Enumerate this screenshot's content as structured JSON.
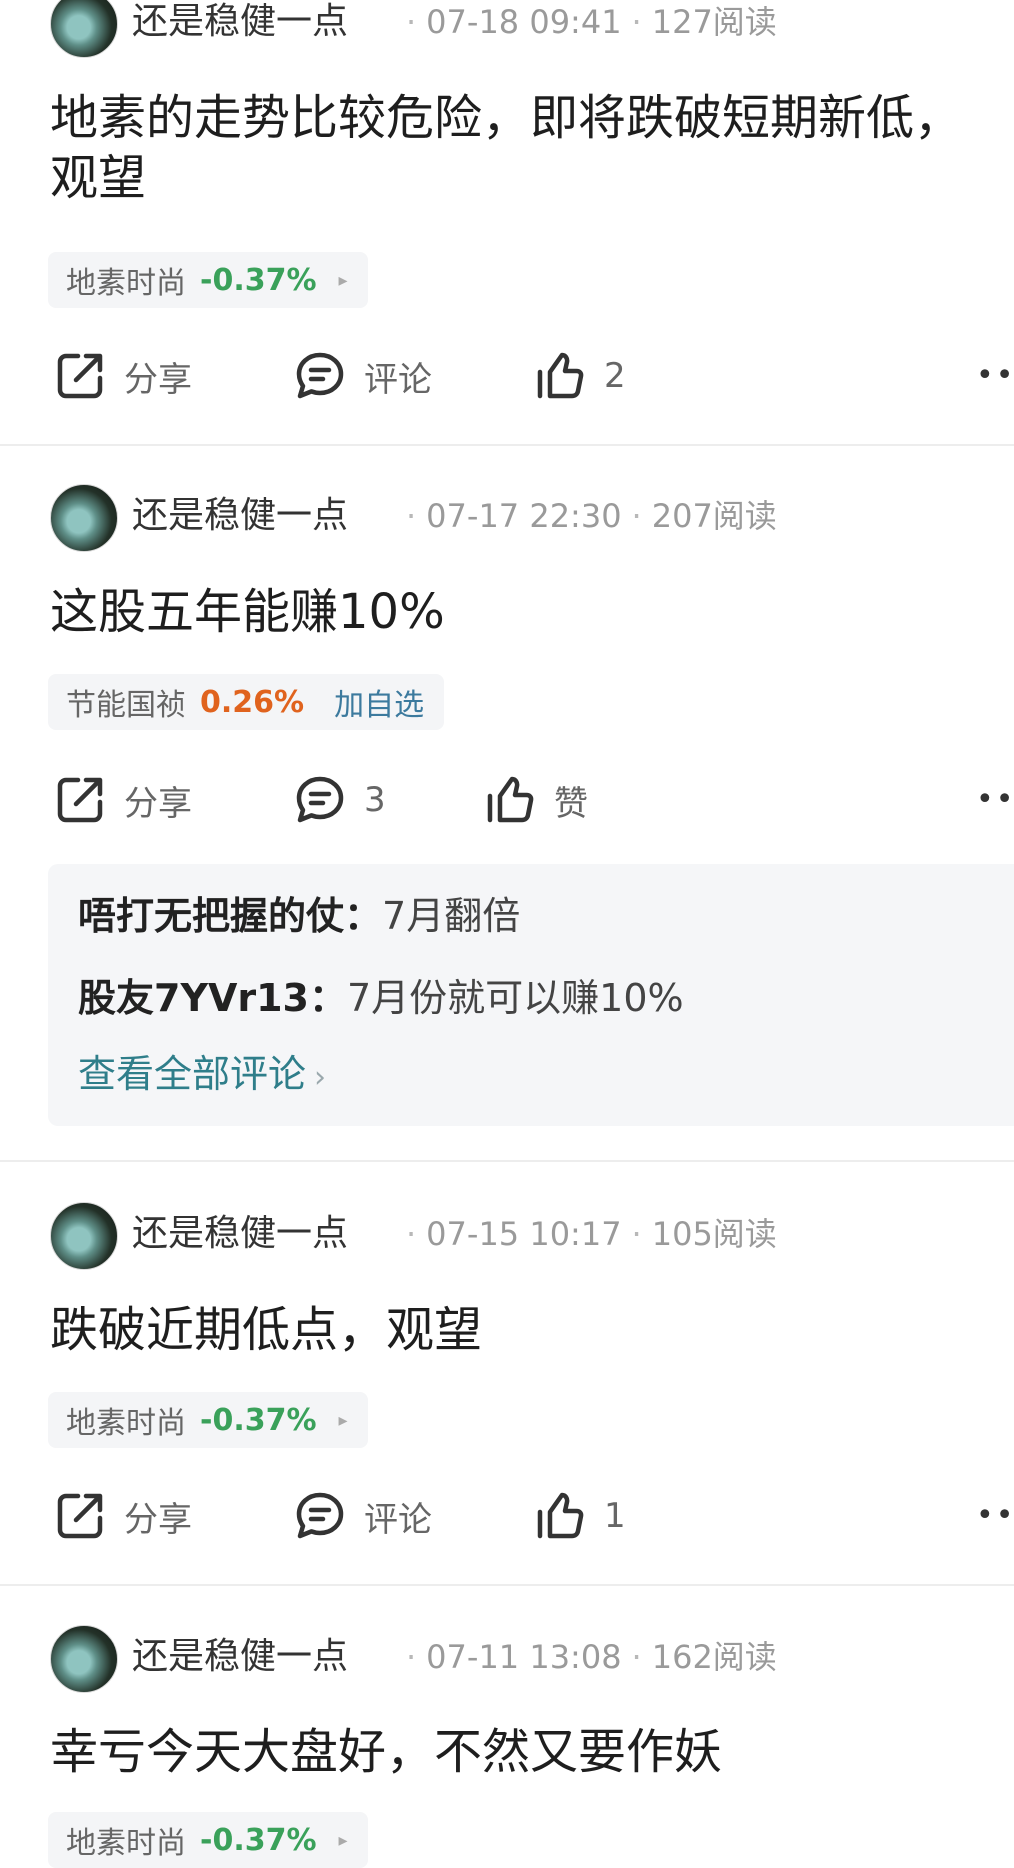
{
  "colors": {
    "down": "#3aa15a",
    "up": "#e0631e",
    "link": "#2f7e8a"
  },
  "icons": {
    "share": "share-icon",
    "comment": "comment-icon",
    "like": "thumbs-up-icon",
    "more": "more-icon"
  },
  "posts": [
    {
      "username": "还是稳健一点",
      "time": "07-18 09:41",
      "reads": "127阅读",
      "content": "地素的走势比较危险，即将跌破短期新低，观望",
      "stock": {
        "name": "地素时尚",
        "change": "-0.37%",
        "arrow": "▸"
      },
      "share_label": "分享",
      "comment_label": "评论",
      "like_label": "2"
    },
    {
      "username": "还是稳健一点",
      "time": "07-17 22:30",
      "reads": "207阅读",
      "content": "这股五年能赚10%",
      "stock": {
        "name": "节能国祯",
        "change": "0.26%",
        "watch": "加自选"
      },
      "share_label": "分享",
      "comment_label": "3",
      "like_label": "赞",
      "comments": [
        {
          "user": "唔打无把握的仗：",
          "text": "7月翻倍"
        },
        {
          "user": "股友7YVr13：",
          "text": "7月份就可以赚10%"
        }
      ],
      "view_all": "查看全部评论",
      "view_all_chevron": "›"
    },
    {
      "username": "还是稳健一点",
      "time": "07-15 10:17",
      "reads": "105阅读",
      "content": "跌破近期低点，观望",
      "stock": {
        "name": "地素时尚",
        "change": "-0.37%",
        "arrow": "▸"
      },
      "share_label": "分享",
      "comment_label": "评论",
      "like_label": "1"
    },
    {
      "username": "还是稳健一点",
      "time": "07-11 13:08",
      "reads": "162阅读",
      "content": "幸亏今天大盘好，不然又要作妖",
      "stock": {
        "name": "地素时尚",
        "change": "-0.37%",
        "arrow": "▸"
      }
    }
  ],
  "more_label": "•••"
}
